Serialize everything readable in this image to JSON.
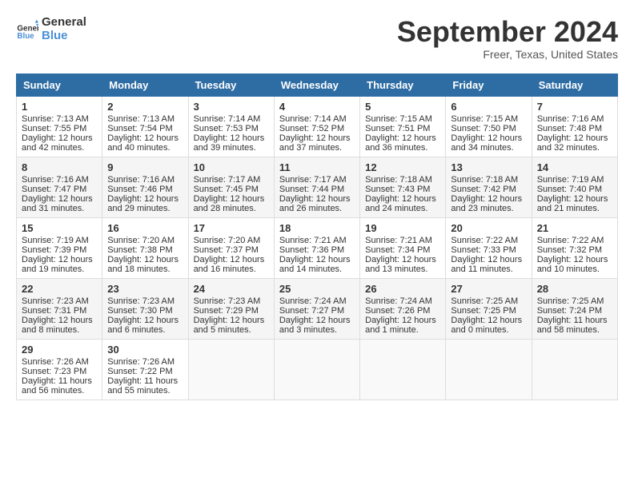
{
  "header": {
    "logo_line1": "General",
    "logo_line2": "Blue",
    "title": "September 2024",
    "subtitle": "Freer, Texas, United States"
  },
  "days_of_week": [
    "Sunday",
    "Monday",
    "Tuesday",
    "Wednesday",
    "Thursday",
    "Friday",
    "Saturday"
  ],
  "weeks": [
    [
      {
        "day": 1,
        "lines": [
          "Sunrise: 7:13 AM",
          "Sunset: 7:55 PM",
          "Daylight: 12 hours",
          "and 42 minutes."
        ]
      },
      {
        "day": 2,
        "lines": [
          "Sunrise: 7:13 AM",
          "Sunset: 7:54 PM",
          "Daylight: 12 hours",
          "and 40 minutes."
        ]
      },
      {
        "day": 3,
        "lines": [
          "Sunrise: 7:14 AM",
          "Sunset: 7:53 PM",
          "Daylight: 12 hours",
          "and 39 minutes."
        ]
      },
      {
        "day": 4,
        "lines": [
          "Sunrise: 7:14 AM",
          "Sunset: 7:52 PM",
          "Daylight: 12 hours",
          "and 37 minutes."
        ]
      },
      {
        "day": 5,
        "lines": [
          "Sunrise: 7:15 AM",
          "Sunset: 7:51 PM",
          "Daylight: 12 hours",
          "and 36 minutes."
        ]
      },
      {
        "day": 6,
        "lines": [
          "Sunrise: 7:15 AM",
          "Sunset: 7:50 PM",
          "Daylight: 12 hours",
          "and 34 minutes."
        ]
      },
      {
        "day": 7,
        "lines": [
          "Sunrise: 7:16 AM",
          "Sunset: 7:48 PM",
          "Daylight: 12 hours",
          "and 32 minutes."
        ]
      }
    ],
    [
      {
        "day": 8,
        "lines": [
          "Sunrise: 7:16 AM",
          "Sunset: 7:47 PM",
          "Daylight: 12 hours",
          "and 31 minutes."
        ]
      },
      {
        "day": 9,
        "lines": [
          "Sunrise: 7:16 AM",
          "Sunset: 7:46 PM",
          "Daylight: 12 hours",
          "and 29 minutes."
        ]
      },
      {
        "day": 10,
        "lines": [
          "Sunrise: 7:17 AM",
          "Sunset: 7:45 PM",
          "Daylight: 12 hours",
          "and 28 minutes."
        ]
      },
      {
        "day": 11,
        "lines": [
          "Sunrise: 7:17 AM",
          "Sunset: 7:44 PM",
          "Daylight: 12 hours",
          "and 26 minutes."
        ]
      },
      {
        "day": 12,
        "lines": [
          "Sunrise: 7:18 AM",
          "Sunset: 7:43 PM",
          "Daylight: 12 hours",
          "and 24 minutes."
        ]
      },
      {
        "day": 13,
        "lines": [
          "Sunrise: 7:18 AM",
          "Sunset: 7:42 PM",
          "Daylight: 12 hours",
          "and 23 minutes."
        ]
      },
      {
        "day": 14,
        "lines": [
          "Sunrise: 7:19 AM",
          "Sunset: 7:40 PM",
          "Daylight: 12 hours",
          "and 21 minutes."
        ]
      }
    ],
    [
      {
        "day": 15,
        "lines": [
          "Sunrise: 7:19 AM",
          "Sunset: 7:39 PM",
          "Daylight: 12 hours",
          "and 19 minutes."
        ]
      },
      {
        "day": 16,
        "lines": [
          "Sunrise: 7:20 AM",
          "Sunset: 7:38 PM",
          "Daylight: 12 hours",
          "and 18 minutes."
        ]
      },
      {
        "day": 17,
        "lines": [
          "Sunrise: 7:20 AM",
          "Sunset: 7:37 PM",
          "Daylight: 12 hours",
          "and 16 minutes."
        ]
      },
      {
        "day": 18,
        "lines": [
          "Sunrise: 7:21 AM",
          "Sunset: 7:36 PM",
          "Daylight: 12 hours",
          "and 14 minutes."
        ]
      },
      {
        "day": 19,
        "lines": [
          "Sunrise: 7:21 AM",
          "Sunset: 7:34 PM",
          "Daylight: 12 hours",
          "and 13 minutes."
        ]
      },
      {
        "day": 20,
        "lines": [
          "Sunrise: 7:22 AM",
          "Sunset: 7:33 PM",
          "Daylight: 12 hours",
          "and 11 minutes."
        ]
      },
      {
        "day": 21,
        "lines": [
          "Sunrise: 7:22 AM",
          "Sunset: 7:32 PM",
          "Daylight: 12 hours",
          "and 10 minutes."
        ]
      }
    ],
    [
      {
        "day": 22,
        "lines": [
          "Sunrise: 7:23 AM",
          "Sunset: 7:31 PM",
          "Daylight: 12 hours",
          "and 8 minutes."
        ]
      },
      {
        "day": 23,
        "lines": [
          "Sunrise: 7:23 AM",
          "Sunset: 7:30 PM",
          "Daylight: 12 hours",
          "and 6 minutes."
        ]
      },
      {
        "day": 24,
        "lines": [
          "Sunrise: 7:23 AM",
          "Sunset: 7:29 PM",
          "Daylight: 12 hours",
          "and 5 minutes."
        ]
      },
      {
        "day": 25,
        "lines": [
          "Sunrise: 7:24 AM",
          "Sunset: 7:27 PM",
          "Daylight: 12 hours",
          "and 3 minutes."
        ]
      },
      {
        "day": 26,
        "lines": [
          "Sunrise: 7:24 AM",
          "Sunset: 7:26 PM",
          "Daylight: 12 hours",
          "and 1 minute."
        ]
      },
      {
        "day": 27,
        "lines": [
          "Sunrise: 7:25 AM",
          "Sunset: 7:25 PM",
          "Daylight: 12 hours",
          "and 0 minutes."
        ]
      },
      {
        "day": 28,
        "lines": [
          "Sunrise: 7:25 AM",
          "Sunset: 7:24 PM",
          "Daylight: 11 hours",
          "and 58 minutes."
        ]
      }
    ],
    [
      {
        "day": 29,
        "lines": [
          "Sunrise: 7:26 AM",
          "Sunset: 7:23 PM",
          "Daylight: 11 hours",
          "and 56 minutes."
        ]
      },
      {
        "day": 30,
        "lines": [
          "Sunrise: 7:26 AM",
          "Sunset: 7:22 PM",
          "Daylight: 11 hours",
          "and 55 minutes."
        ]
      },
      null,
      null,
      null,
      null,
      null
    ]
  ]
}
